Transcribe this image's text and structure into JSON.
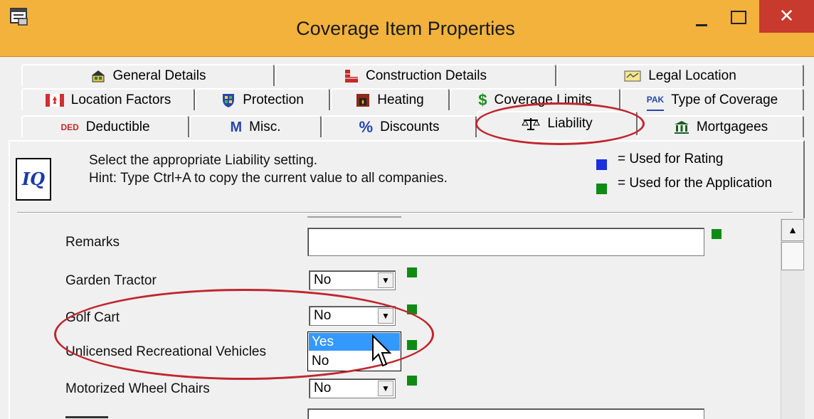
{
  "window": {
    "title": "Coverage Item Properties",
    "close_glyph": "✕",
    "min_glyph": "–",
    "max_glyph": "☐"
  },
  "tabs": {
    "row1": [
      {
        "label": "General Details",
        "icon": "house-icon"
      },
      {
        "label": "Construction Details",
        "icon": "brick-wall-icon"
      },
      {
        "label": "Legal Location",
        "icon": "envelope-map-icon"
      }
    ],
    "row2": [
      {
        "label": "Location Factors",
        "icon": "canada-flag-icon"
      },
      {
        "label": "Protection",
        "icon": "shield-icon"
      },
      {
        "label": "Heating",
        "icon": "fireplace-icon"
      },
      {
        "label": "Coverage Limits",
        "icon": "dollar-icon",
        "dollar": "$"
      },
      {
        "label": "Type of Coverage",
        "icon": "pak-icon",
        "icon_text": "PAK"
      }
    ],
    "row3": [
      {
        "label": "Deductible",
        "icon": "ded-icon",
        "icon_text": "DED"
      },
      {
        "label": "Misc.",
        "icon": "m-icon",
        "icon_text": "M"
      },
      {
        "label": "Discounts",
        "icon": "percent-icon",
        "icon_text": "%"
      },
      {
        "label": "Liability",
        "icon": "scales-icon",
        "active": true
      },
      {
        "label": "Mortgagees",
        "icon": "bank-icon"
      }
    ]
  },
  "header": {
    "line1": "Select the appropriate Liability setting.",
    "line2": "Hint: Type Ctrl+A to copy the current value to all companies.",
    "iq_icon_text": "IQ",
    "legend": [
      {
        "text": "= Used for Rating",
        "color": "#1a2fe0"
      },
      {
        "text": "= Used for the Application",
        "color": "#0f8b14"
      }
    ]
  },
  "form": {
    "remarks_label": "Remarks",
    "remarks_value": "",
    "rows": [
      {
        "label": "Garden Tractor",
        "value": "No"
      },
      {
        "label": "Golf Cart",
        "value": "No"
      },
      {
        "label": "Unlicensed Recreational Vehicles",
        "value": "No"
      },
      {
        "label": "Motorized Wheel Chairs",
        "value": "No"
      }
    ],
    "dropdown_options": [
      "Yes",
      "No"
    ],
    "dropdown_selected": "Yes"
  },
  "colors": {
    "titlebar": "#f2b23c",
    "close": "#c8392e",
    "highlight": "#3399ff",
    "annotation": "#c0262d"
  }
}
